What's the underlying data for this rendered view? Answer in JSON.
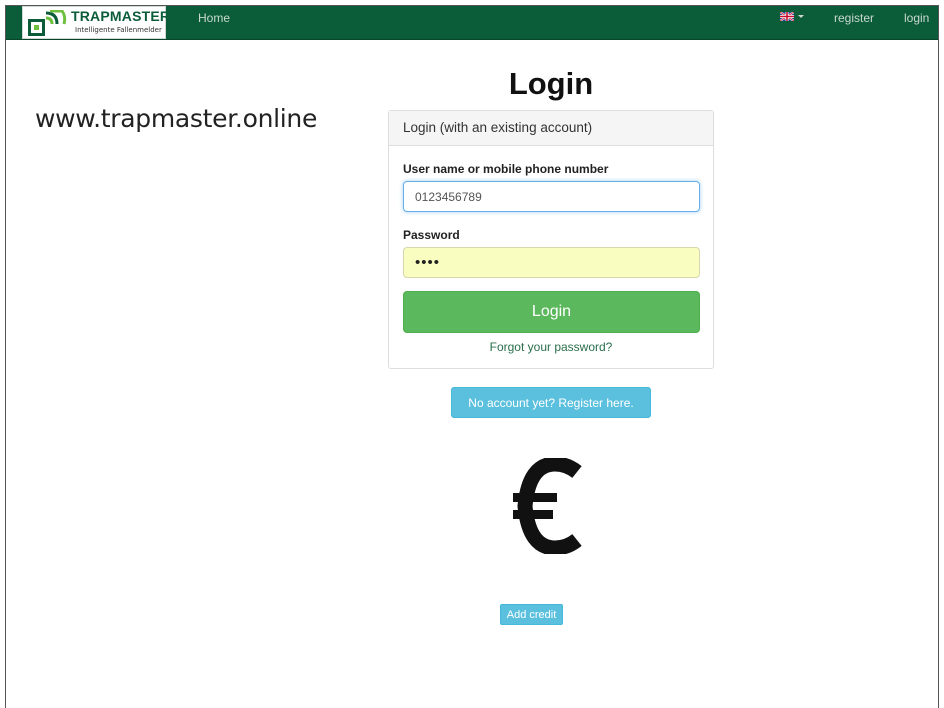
{
  "navbar": {
    "brand_title": "TRAPMASTER",
    "brand_subtitle": "Intelligente Fallenmelder",
    "home_label": "Home",
    "language_icon": "uk-flag-icon",
    "register_label": "register",
    "login_label": "login",
    "bg_color": "#0b5d3a"
  },
  "website_text": "www.trapmaster.online",
  "page_title": "Login",
  "login_panel": {
    "heading": "Login (with an existing account)",
    "username_label": "User name or mobile phone number",
    "username_value": "0123456789",
    "password_label": "Password",
    "password_value": "••••",
    "login_button": "Login",
    "forgot_link": "Forgot your password?"
  },
  "register_button": "No account yet? Register here.",
  "euro_icon": "euro-icon",
  "add_credit_button": "Add credit",
  "colors": {
    "success": "#5cb85c",
    "info": "#5bc0de",
    "autofill": "#fafdc0"
  }
}
